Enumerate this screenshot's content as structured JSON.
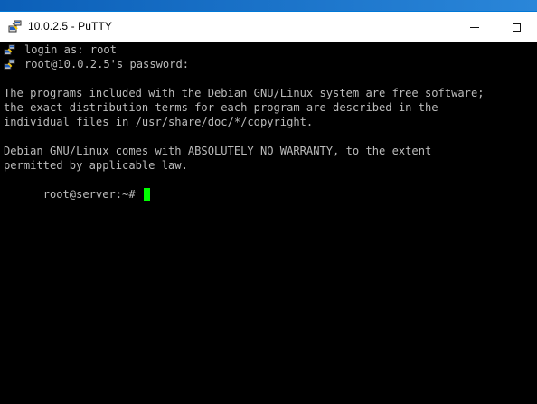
{
  "window": {
    "title": "10.0.2.5 - PuTTY",
    "app_icon": "putty-icon"
  },
  "terminal": {
    "login_prompt": "login as: root",
    "password_prompt": "root@10.0.2.5's password:",
    "line1": "The programs included with the Debian GNU/Linux system are free software;",
    "line2": "the exact distribution terms for each program are described in the",
    "line3": "individual files in /usr/share/doc/*/copyright.",
    "line4": "Debian GNU/Linux comes with ABSOLUTELY NO WARRANTY, to the extent",
    "line5": "permitted by applicable law.",
    "shell_prompt": "root@server:~# "
  },
  "colors": {
    "terminal_bg": "#000000",
    "terminal_text": "#bbbbbb",
    "cursor": "#00ff00",
    "titlebar_bg": "#ffffff"
  }
}
